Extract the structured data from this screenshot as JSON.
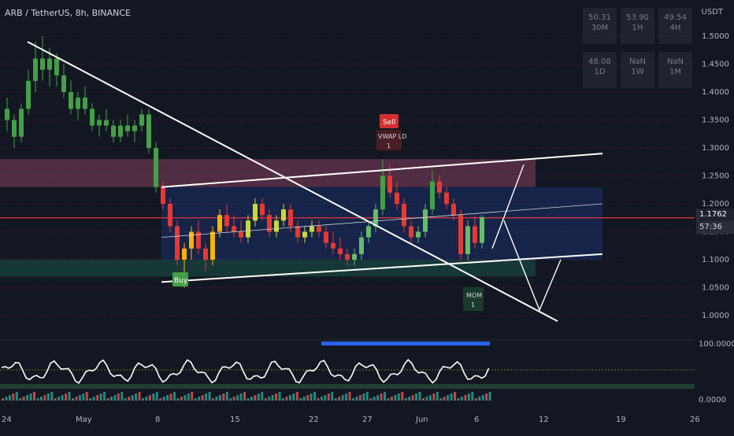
{
  "header": {
    "title": "ARB / TetherUS, 8h, BINANCE",
    "currency": "USDT"
  },
  "rsi_table": [
    {
      "value": "50.31",
      "tf": "30M"
    },
    {
      "value": "53.90",
      "tf": "1H"
    },
    {
      "value": "49.54",
      "tf": "4H"
    },
    {
      "value": "48.08",
      "tf": "1D"
    },
    {
      "value": "NaN",
      "tf": "1W"
    },
    {
      "value": "NaN",
      "tf": "1M"
    }
  ],
  "price_axis": [
    "1.5000",
    "1.4500",
    "1.4000",
    "1.3500",
    "1.3000",
    "1.2500",
    "1.2000",
    "1.1500",
    "1.1000",
    "1.0500",
    "1.0000"
  ],
  "current_price": {
    "value": "1.1762",
    "countdown": "57:36"
  },
  "indicator_axis": [
    "100.0000",
    "0.0000"
  ],
  "time_axis": [
    "24",
    "May",
    "8",
    "15",
    "22",
    "27",
    "Jun",
    "6",
    "12",
    "19",
    "26"
  ],
  "annotations": {
    "sell_label": "Sell",
    "sell_sub": "VWAP LD",
    "sell_count": "1",
    "buy_label": "Buy",
    "mom_label": "MOM",
    "mom_count": "1"
  },
  "colors": {
    "background": "#131722",
    "up": "#26a69a",
    "down": "#ef5350",
    "resistance_zone": "#f0679a",
    "support_zone": "#1f8f6a",
    "channel": "#2962ff"
  },
  "chart_data": {
    "type": "candlestick",
    "symbol": "ARB / TetherUS",
    "interval": "8h",
    "exchange": "BINANCE",
    "ylim": [
      0.97,
      1.53
    ],
    "series": [
      {
        "values": [
          [
            1.37,
            1.39,
            1.33,
            1.35
          ],
          [
            1.35,
            1.36,
            1.3,
            1.32
          ],
          [
            1.32,
            1.38,
            1.31,
            1.37
          ],
          [
            1.37,
            1.44,
            1.36,
            1.42
          ],
          [
            1.42,
            1.49,
            1.4,
            1.46
          ],
          [
            1.46,
            1.5,
            1.42,
            1.44
          ],
          [
            1.44,
            1.48,
            1.41,
            1.46
          ],
          [
            1.46,
            1.47,
            1.41,
            1.43
          ],
          [
            1.43,
            1.45,
            1.39,
            1.4
          ],
          [
            1.4,
            1.42,
            1.36,
            1.37
          ],
          [
            1.37,
            1.4,
            1.35,
            1.39
          ],
          [
            1.39,
            1.41,
            1.36,
            1.37
          ],
          [
            1.37,
            1.38,
            1.33,
            1.34
          ],
          [
            1.34,
            1.36,
            1.32,
            1.35
          ],
          [
            1.35,
            1.37,
            1.33,
            1.34
          ],
          [
            1.34,
            1.35,
            1.31,
            1.32
          ],
          [
            1.32,
            1.35,
            1.31,
            1.34
          ],
          [
            1.34,
            1.36,
            1.32,
            1.33
          ],
          [
            1.33,
            1.35,
            1.31,
            1.34
          ],
          [
            1.34,
            1.37,
            1.33,
            1.36
          ],
          [
            1.36,
            1.37,
            1.29,
            1.3
          ],
          [
            1.3,
            1.31,
            1.22,
            1.23
          ],
          [
            1.23,
            1.24,
            1.19,
            1.2
          ],
          [
            1.2,
            1.21,
            1.15,
            1.16
          ],
          [
            1.16,
            1.17,
            1.09,
            1.1
          ],
          [
            1.1,
            1.13,
            1.05,
            1.12
          ],
          [
            1.12,
            1.16,
            1.1,
            1.15
          ],
          [
            1.15,
            1.17,
            1.11,
            1.12
          ],
          [
            1.12,
            1.13,
            1.08,
            1.1
          ],
          [
            1.1,
            1.16,
            1.09,
            1.15
          ],
          [
            1.15,
            1.19,
            1.14,
            1.18
          ],
          [
            1.18,
            1.2,
            1.15,
            1.16
          ],
          [
            1.16,
            1.18,
            1.14,
            1.15
          ],
          [
            1.15,
            1.17,
            1.13,
            1.14
          ],
          [
            1.14,
            1.18,
            1.13,
            1.17
          ],
          [
            1.17,
            1.21,
            1.16,
            1.2
          ],
          [
            1.2,
            1.21,
            1.17,
            1.18
          ],
          [
            1.18,
            1.19,
            1.14,
            1.15
          ],
          [
            1.15,
            1.18,
            1.14,
            1.17
          ],
          [
            1.17,
            1.2,
            1.16,
            1.19
          ],
          [
            1.19,
            1.2,
            1.15,
            1.16
          ],
          [
            1.16,
            1.17,
            1.13,
            1.14
          ],
          [
            1.14,
            1.16,
            1.13,
            1.15
          ],
          [
            1.15,
            1.17,
            1.14,
            1.16
          ],
          [
            1.16,
            1.17,
            1.14,
            1.15
          ],
          [
            1.15,
            1.16,
            1.12,
            1.13
          ],
          [
            1.13,
            1.15,
            1.11,
            1.12
          ],
          [
            1.12,
            1.14,
            1.1,
            1.11
          ],
          [
            1.11,
            1.12,
            1.09,
            1.1
          ],
          [
            1.1,
            1.12,
            1.09,
            1.11
          ],
          [
            1.11,
            1.15,
            1.1,
            1.14
          ],
          [
            1.14,
            1.17,
            1.13,
            1.16
          ],
          [
            1.16,
            1.2,
            1.15,
            1.19
          ],
          [
            1.19,
            1.28,
            1.18,
            1.25
          ],
          [
            1.25,
            1.27,
            1.21,
            1.22
          ],
          [
            1.22,
            1.24,
            1.19,
            1.2
          ],
          [
            1.2,
            1.21,
            1.15,
            1.16
          ],
          [
            1.16,
            1.17,
            1.13,
            1.14
          ],
          [
            1.14,
            1.16,
            1.13,
            1.15
          ],
          [
            1.15,
            1.2,
            1.14,
            1.19
          ],
          [
            1.19,
            1.26,
            1.18,
            1.24
          ],
          [
            1.24,
            1.25,
            1.21,
            1.22
          ],
          [
            1.22,
            1.23,
            1.19,
            1.2
          ],
          [
            1.2,
            1.21,
            1.17,
            1.18
          ],
          [
            1.18,
            1.19,
            1.1,
            1.11
          ],
          [
            1.11,
            1.17,
            1.1,
            1.16
          ],
          [
            1.16,
            1.18,
            1.12,
            1.13
          ],
          [
            1.13,
            1.18,
            1.12,
            1.1762
          ]
        ]
      }
    ],
    "zones": [
      {
        "name": "resistance",
        "from": 1.23,
        "to": 1.28
      },
      {
        "name": "support",
        "from": 1.07,
        "to": 1.1
      }
    ],
    "horizontal_lines": [
      1.175
    ],
    "indicator": {
      "type": "oscillator",
      "range": [
        0,
        100
      ]
    }
  }
}
